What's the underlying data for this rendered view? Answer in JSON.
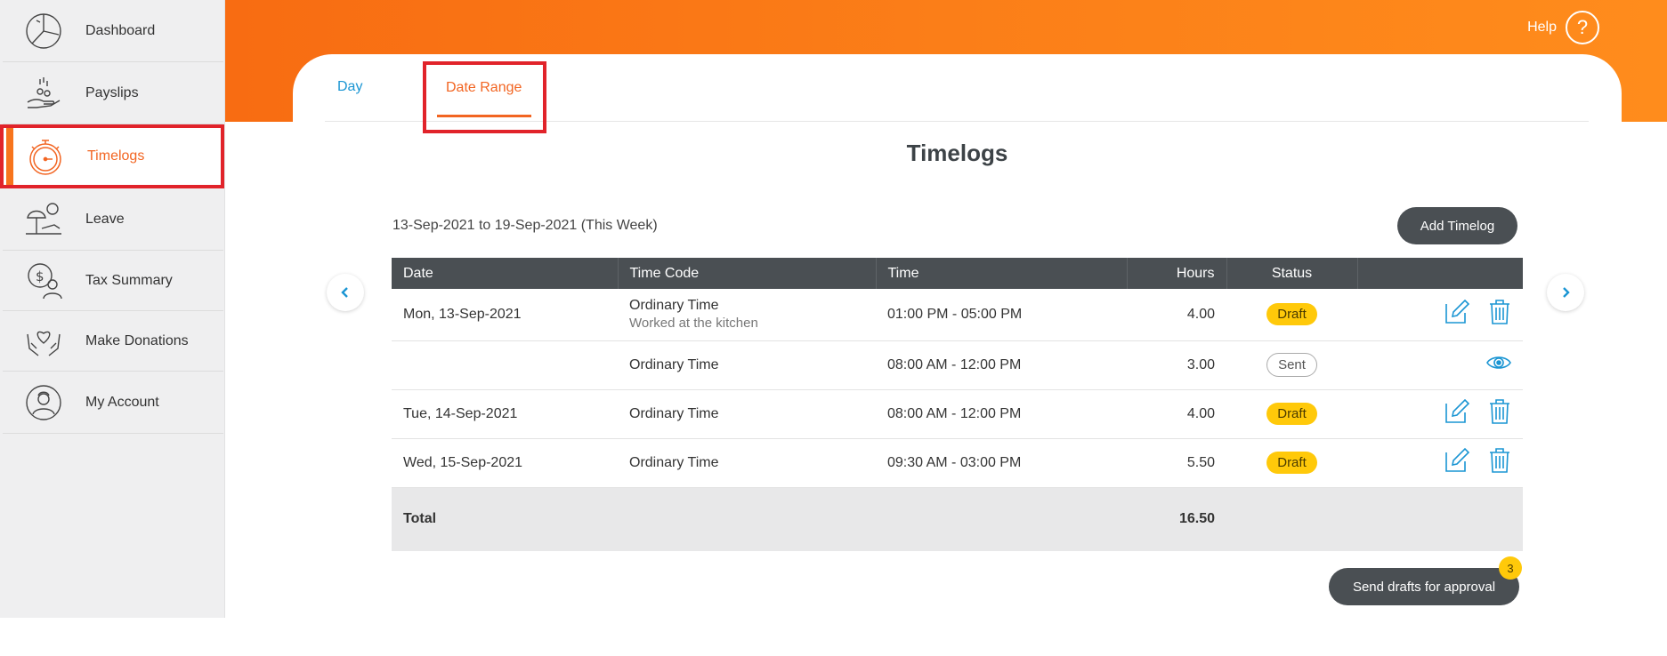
{
  "sidebar": {
    "items": [
      {
        "label": "Dashboard",
        "icon": "dashboard-pie-icon"
      },
      {
        "label": "Payslips",
        "icon": "payslip-coins-icon"
      },
      {
        "label": "Timelogs",
        "icon": "stopwatch-icon",
        "active": true
      },
      {
        "label": "Leave",
        "icon": "beach-umbrella-icon"
      },
      {
        "label": "Tax Summary",
        "icon": "tax-person-icon"
      },
      {
        "label": "Make Donations",
        "icon": "heart-hands-icon"
      },
      {
        "label": "My Account",
        "icon": "account-avatar-icon"
      }
    ]
  },
  "header": {
    "help_label": "Help",
    "help_icon": "?"
  },
  "tabs": {
    "day": "Day",
    "date_range": "Date Range",
    "active": "date_range"
  },
  "main": {
    "title": "Timelogs",
    "range_text": "13-Sep-2021 to 19-Sep-2021 (This Week)",
    "add_button": "Add Timelog",
    "send_button": "Send drafts for approval",
    "draft_count": "3"
  },
  "table": {
    "headers": [
      "Date",
      "Time Code",
      "Time",
      "Hours",
      "Status"
    ],
    "rows": [
      {
        "date": "Mon, 13-Sep-2021",
        "time_code": "Ordinary Time",
        "note": "Worked at the kitchen",
        "time": "01:00 PM - 05:00 PM",
        "hours": "4.00",
        "status": "Draft"
      },
      {
        "date": "",
        "time_code": "Ordinary Time",
        "note": "",
        "time": "08:00 AM - 12:00 PM",
        "hours": "3.00",
        "status": "Sent"
      },
      {
        "date": "Tue, 14-Sep-2021",
        "time_code": "Ordinary Time",
        "note": "",
        "time": "08:00 AM - 12:00 PM",
        "hours": "4.00",
        "status": "Draft"
      },
      {
        "date": "Wed, 15-Sep-2021",
        "time_code": "Ordinary Time",
        "note": "",
        "time": "09:30 AM - 03:00 PM",
        "hours": "5.50",
        "status": "Draft"
      }
    ],
    "total_label": "Total",
    "total_hours": "16.50"
  },
  "colors": {
    "accent_orange": "#f26522",
    "link_blue": "#1a95d3",
    "dark_button": "#4a4f53",
    "draft_yellow": "#ffc90a",
    "highlight_red": "#e1232a"
  }
}
